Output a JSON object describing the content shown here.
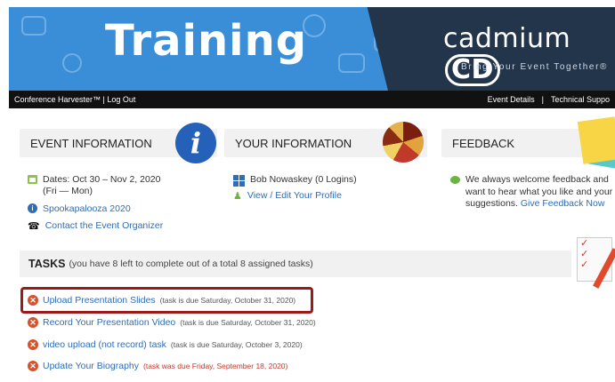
{
  "banner": {
    "title": "Training",
    "brand_text": "cadmium",
    "brand_cd": "CD",
    "tagline": "Bring Your Event Together®"
  },
  "navbar": {
    "left": "Conference Harvester™  |  Log Out",
    "event_details": "Event Details",
    "separator": "|",
    "technical_support": "Technical Suppo"
  },
  "event_info": {
    "heading": "EVENT INFORMATION",
    "dates_label": "Dates: Oct 30 – Nov 2, 2020",
    "dates_days": "(Fri — Mon)",
    "event_name": "Spookapalooza 2020",
    "contact": "Contact the Event Organizer",
    "icons": [
      "calendar-icon",
      "info-icon",
      "phone-icon"
    ]
  },
  "your_info": {
    "heading": "YOUR INFORMATION",
    "user": "Bob Nowaskey (0 Logins)",
    "profile_link": "View / Edit Your Profile"
  },
  "feedback": {
    "heading": "FEEDBACK",
    "text_line1": "We always welcome feedback and",
    "text_line2": "want to hear what you like and your",
    "text_line3": "suggestions.",
    "link": "Give Feedback Now"
  },
  "tasks": {
    "heading": "TASKS",
    "summary": "(you have 8 left to complete out of a total 8 assigned tasks)",
    "items": [
      {
        "label": "Upload Presentation Slides",
        "due": "(task is due Saturday, October 31, 2020)"
      },
      {
        "label": "Record Your Presentation Video",
        "due": "(task is due Saturday, October 31, 2020)"
      },
      {
        "label": "video upload (not record) task",
        "due": "(task is due Saturday, October 3, 2020)"
      },
      {
        "label": "Update Your Biography",
        "due": "(task was due Friday, September 18, 2020)"
      }
    ]
  },
  "colors": {
    "banner_blue": "#3a8ed8",
    "banner_dark": "#22354a",
    "link_blue": "#2f6db5",
    "task_x": "#d6522d",
    "highlight_border": "#9b1b1b"
  }
}
